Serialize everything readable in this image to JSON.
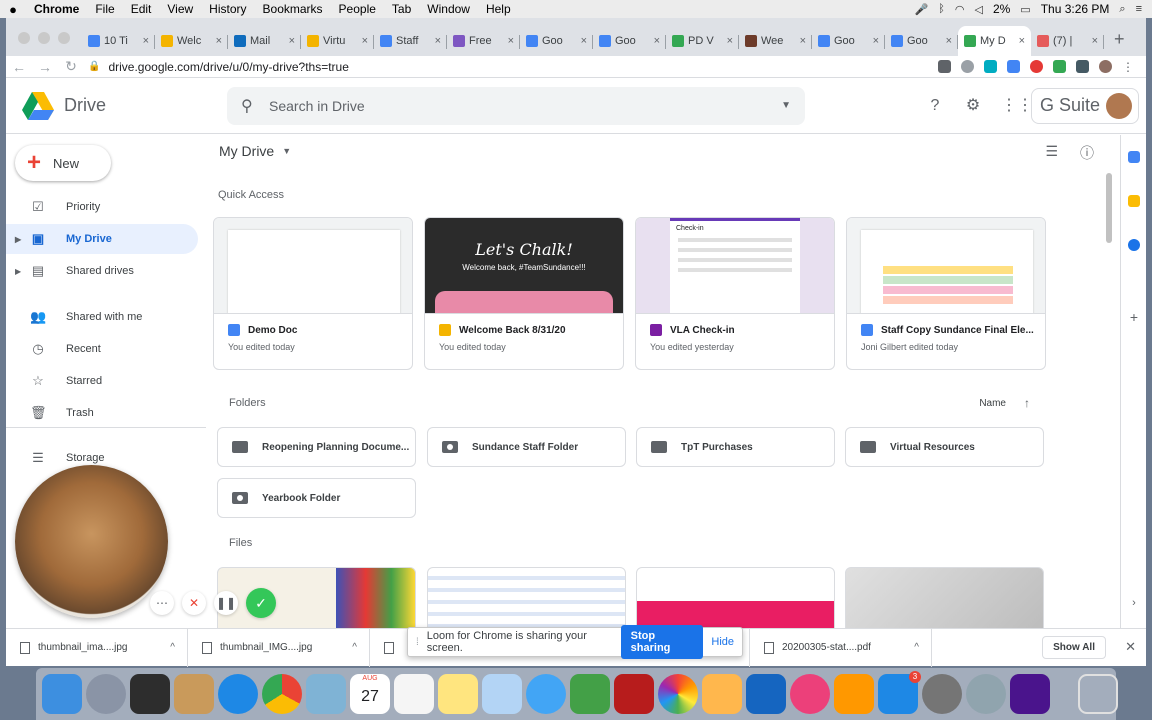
{
  "menubar": {
    "app": "Chrome",
    "items": [
      "File",
      "Edit",
      "View",
      "History",
      "Bookmarks",
      "People",
      "Tab",
      "Window",
      "Help"
    ],
    "battery": "2%",
    "clock": "Thu 3:26 PM"
  },
  "tabs": [
    {
      "label": "10 Ti",
      "color": "#4285f4"
    },
    {
      "label": "Welc",
      "color": "#f4b400"
    },
    {
      "label": "Mail",
      "color": "#0f6cbd"
    },
    {
      "label": "Virtu",
      "color": "#f4b400"
    },
    {
      "label": "Staff",
      "color": "#4285f4"
    },
    {
      "label": "Free",
      "color": "#7e57c2"
    },
    {
      "label": "Goo",
      "color": "#4285f4"
    },
    {
      "label": "Goo",
      "color": "#4285f4"
    },
    {
      "label": "PD V",
      "color": "#34a853"
    },
    {
      "label": "Wee",
      "color": "#6d3b2a"
    },
    {
      "label": "Goo",
      "color": "#4285f4"
    },
    {
      "label": "Goo",
      "color": "#4285f4"
    },
    {
      "label": "My D",
      "color": "#34a853",
      "active": true
    },
    {
      "label": "(7) |",
      "color": "#e55b5b"
    }
  ],
  "url": "drive.google.com/drive/u/0/my-drive?ths=true",
  "drive": {
    "app_name": "Drive",
    "search_placeholder": "Search in Drive",
    "suite": "G Suite",
    "new_label": "New",
    "nav": [
      {
        "label": "Priority",
        "icon": "check-box-icon"
      },
      {
        "label": "My Drive",
        "icon": "drive-icon",
        "selected": true
      },
      {
        "label": "Shared drives",
        "icon": "shared-drives-icon"
      },
      {
        "label": "Shared with me",
        "icon": "people-icon"
      },
      {
        "label": "Recent",
        "icon": "clock-icon"
      },
      {
        "label": "Starred",
        "icon": "star-icon"
      },
      {
        "label": "Trash",
        "icon": "trash-icon"
      },
      {
        "label": "Storage",
        "icon": "storage-icon"
      }
    ],
    "breadcrumb": "My Drive",
    "quick_access_title": "Quick Access",
    "quick_access": [
      {
        "name": "Demo Doc",
        "sub": "You edited today",
        "icon_color": "#4285f4"
      },
      {
        "name": "Welcome Back 8/31/20",
        "sub": "You edited today",
        "icon_color": "#f4b400",
        "thumb_title": "Let's Chalk!",
        "thumb_sub": "Welcome back, #TeamSundance!!!"
      },
      {
        "name": "VLA Check-in",
        "sub": "You edited yesterday",
        "icon_color": "#7b1fa2",
        "thumb_title": "Check-in"
      },
      {
        "name": "Staff Copy Sundance Final Ele...",
        "sub": "Joni Gilbert edited today",
        "icon_color": "#4285f4"
      }
    ],
    "folders_title": "Folders",
    "sort_label": "Name",
    "folders": [
      {
        "name": "Reopening Planning Docume...",
        "shared": false
      },
      {
        "name": "Sundance Staff Folder",
        "shared": true
      },
      {
        "name": "TpT Purchases",
        "shared": false
      },
      {
        "name": "Virtual Resources",
        "shared": false
      },
      {
        "name": "Yearbook Folder",
        "shared": true
      }
    ],
    "files_title": "Files"
  },
  "downloads": [
    {
      "name": "thumbnail_ima....jpg"
    },
    {
      "name": "thumbnail_IMG....jpg"
    },
    {
      "name": "20200305-stat....pdf"
    }
  ],
  "show_all": "Show All",
  "loom": {
    "message": "Loom for Chrome is sharing your screen.",
    "stop": "Stop sharing",
    "hide": "Hide"
  },
  "dock_date": "27",
  "dock_month": "AUG"
}
